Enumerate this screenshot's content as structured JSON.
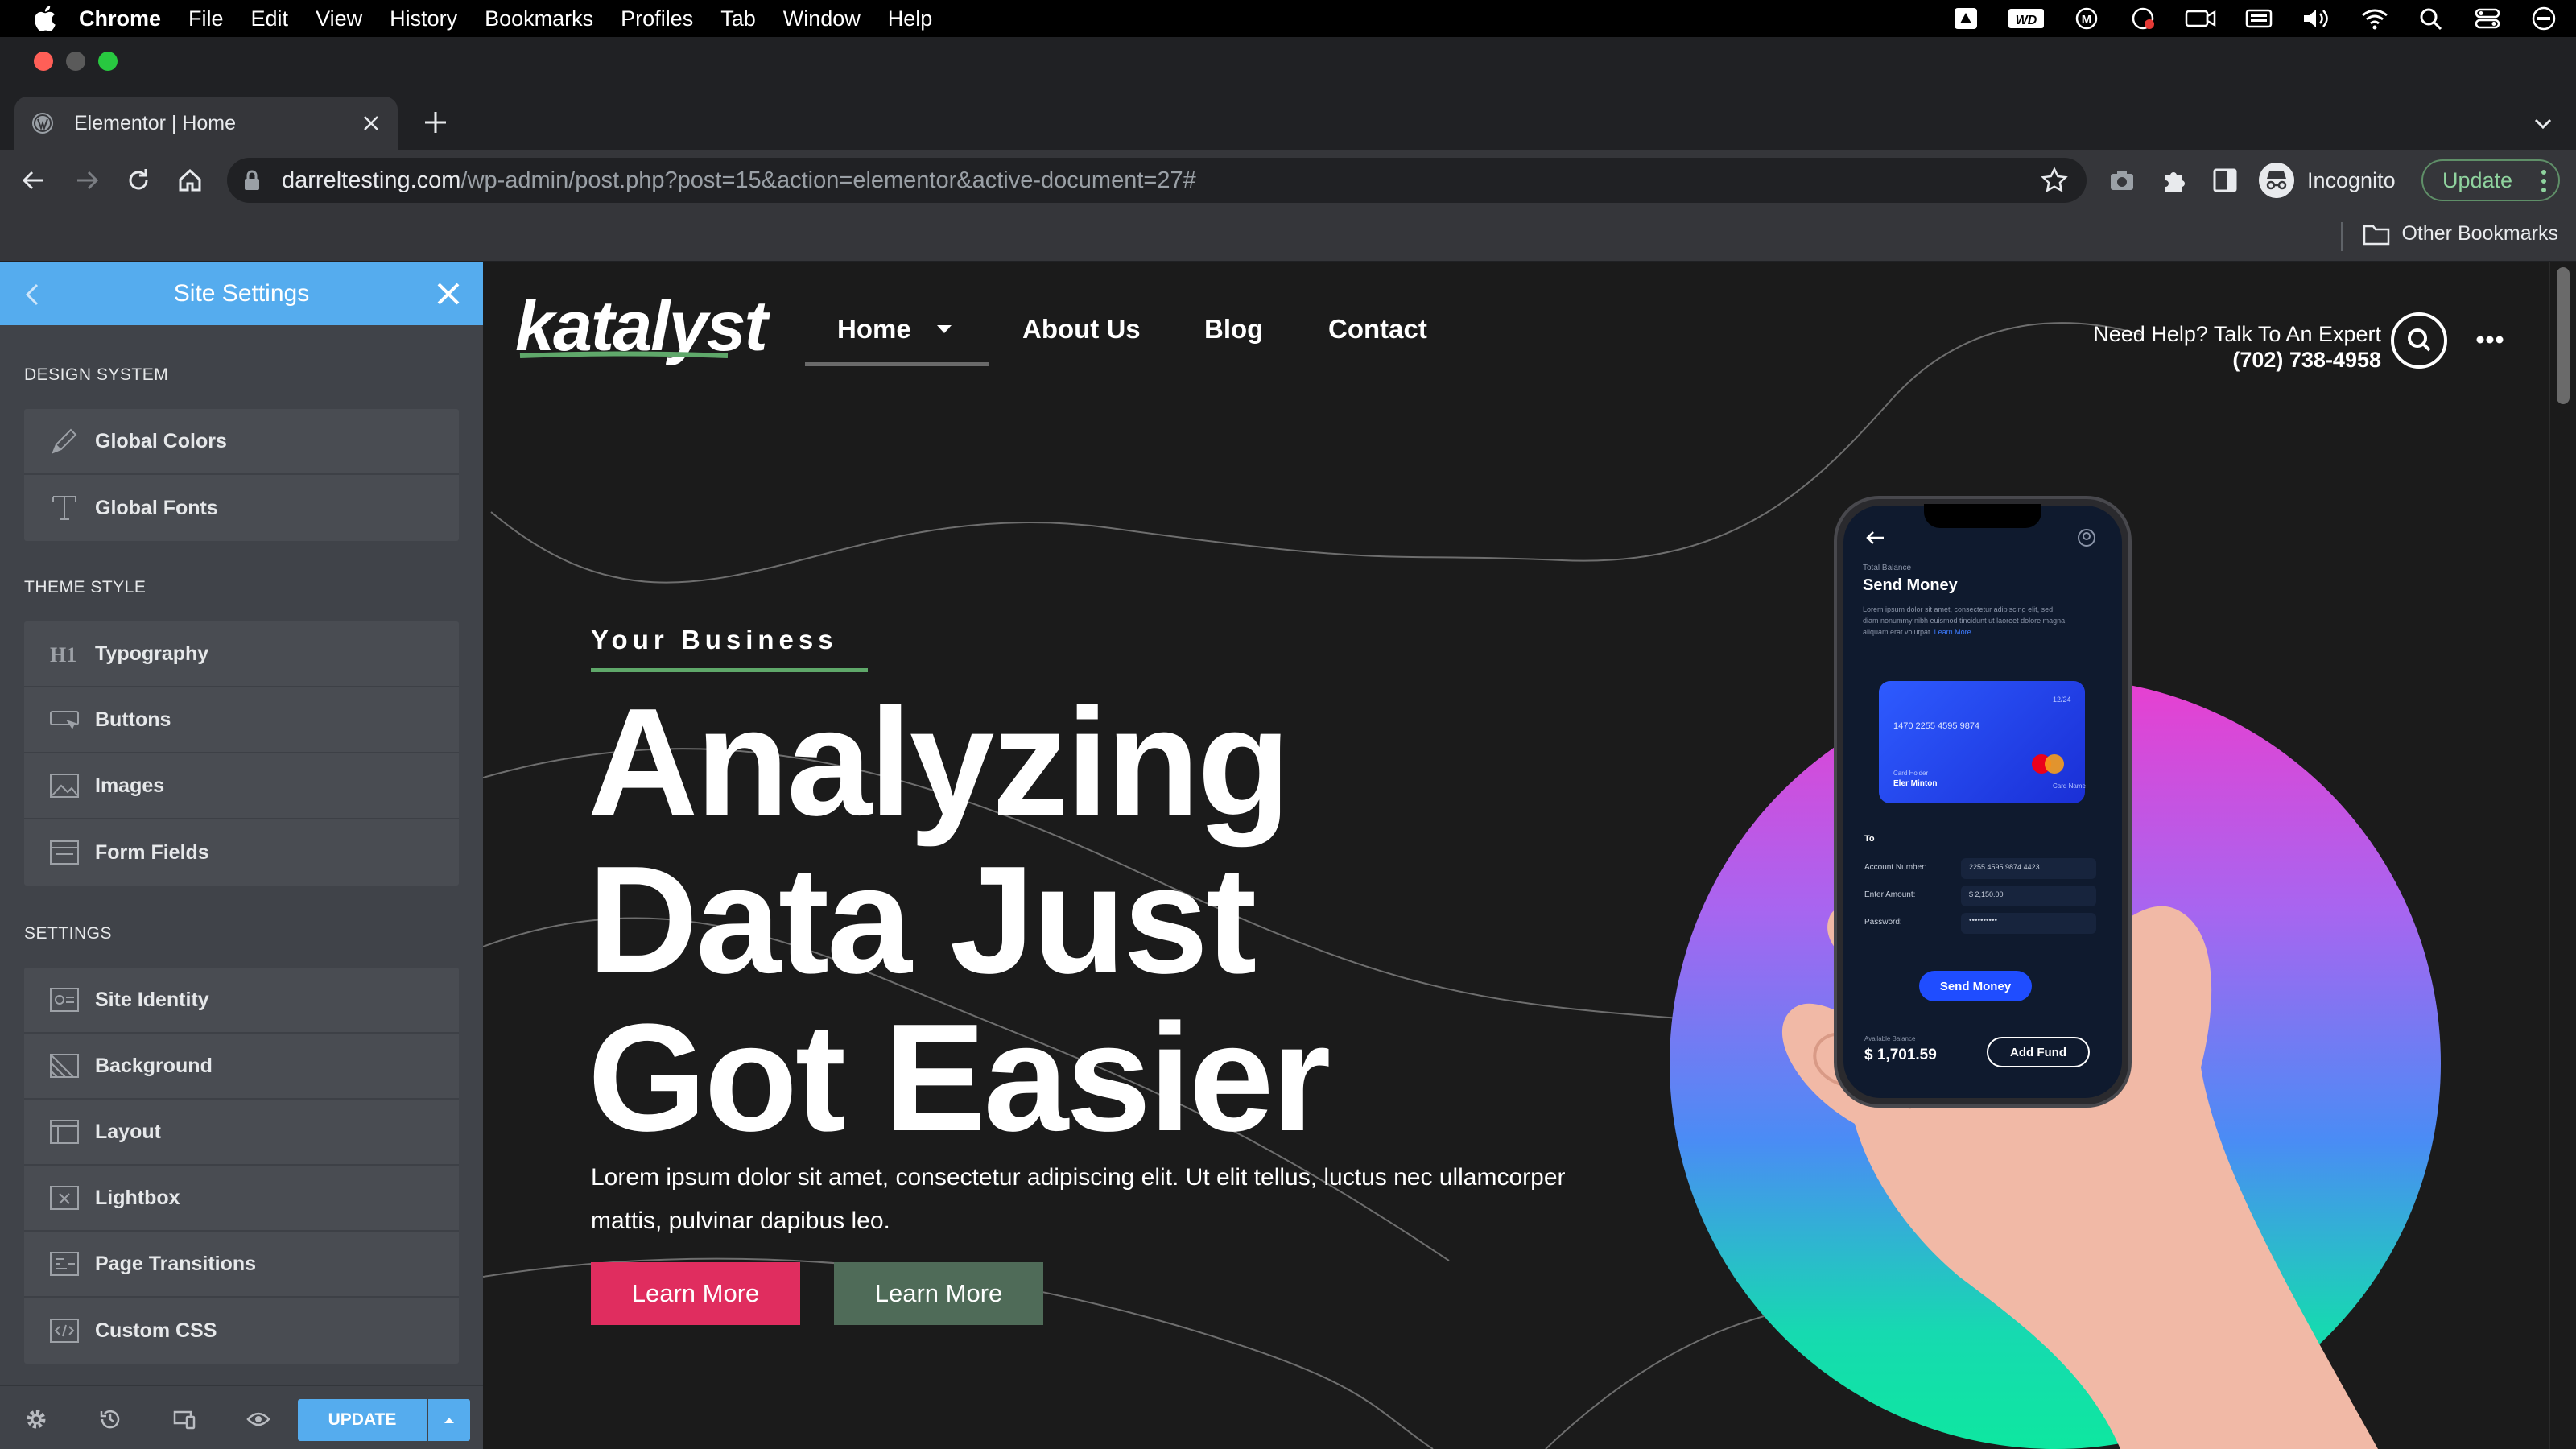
{
  "menubar": {
    "app": "Chrome",
    "items": [
      "File",
      "Edit",
      "View",
      "History",
      "Bookmarks",
      "Profiles",
      "Tab",
      "Window",
      "Help"
    ]
  },
  "browser": {
    "tab_title": "Elementor | Home",
    "url_host": "darreltesting.com",
    "url_path": "/wp-admin/post.php?post=15&action=elementor&active-document=27#",
    "profile_label": "Incognito",
    "update_label": "Update",
    "bookmark_other": "Other Bookmarks"
  },
  "panel": {
    "title": "Site Settings",
    "sections": [
      {
        "title": "DESIGN SYSTEM",
        "items": [
          {
            "label": "Global Colors",
            "icon": "brush-icon"
          },
          {
            "label": "Global Fonts",
            "icon": "font-icon"
          }
        ]
      },
      {
        "title": "THEME STYLE",
        "items": [
          {
            "label": "Typography",
            "icon": "heading-icon"
          },
          {
            "label": "Buttons",
            "icon": "button-icon"
          },
          {
            "label": "Images",
            "icon": "image-icon"
          },
          {
            "label": "Form Fields",
            "icon": "form-icon"
          }
        ]
      },
      {
        "title": "SETTINGS",
        "items": [
          {
            "label": "Site Identity",
            "icon": "site-identity-icon"
          },
          {
            "label": "Background",
            "icon": "background-icon"
          },
          {
            "label": "Layout",
            "icon": "layout-icon"
          },
          {
            "label": "Lightbox",
            "icon": "lightbox-icon"
          },
          {
            "label": "Page Transitions",
            "icon": "page-transitions-icon"
          },
          {
            "label": "Custom CSS",
            "icon": "code-icon"
          }
        ]
      }
    ],
    "footer_update": "UPDATE"
  },
  "site": {
    "logo": "katalyst",
    "nav": [
      "Home",
      "About Us",
      "Blog",
      "Contact"
    ],
    "help_line1": "Need Help? Talk To An Expert",
    "help_line2": "(702) 738-4958",
    "kicker": "Your Business",
    "headline": [
      "Analyzing",
      "Data Just",
      "Got Easier"
    ],
    "paragraph": "Lorem ipsum dolor sit amet, consectetur adipiscing elit. Ut elit tellus, luctus nec ullamcorper mattis, pulvinar dapibus leo.",
    "button_primary": "Learn More",
    "button_secondary": "Learn More",
    "phone": {
      "small_label": "Total Balance",
      "title": "Send Money",
      "body": "Lorem ipsum dolor sit amet, consectetur adipiscing elit, sed diam nonummy nibh euismod tincidunt ut laoreet dolore magna aliquam erat volutpat.",
      "learn_more": "Learn More",
      "card_expiry": "12/24",
      "card_number": "1470 2255 4595 9874",
      "card_holder_label": "Card Holder",
      "card_holder": "Eler Minton",
      "card_name_label": "Card Name",
      "to_label": "To",
      "account_label": "Account Number:",
      "account_value": "2255 4595 9874 4423",
      "amount_label": "Enter Amount:",
      "amount_value": "$ 2,150.00",
      "password_label": "Password:",
      "password_value": "••••••••••",
      "send_button": "Send Money",
      "available_label": "Available Balance",
      "available_value": "$ 1,701.59",
      "add_fund": "Add Fund"
    }
  },
  "colors": {
    "panel_accent": "#55acee",
    "primary_button": "#e02d5f",
    "secondary_button": "#4f6b58",
    "logo_underline": "#5fa86a"
  }
}
